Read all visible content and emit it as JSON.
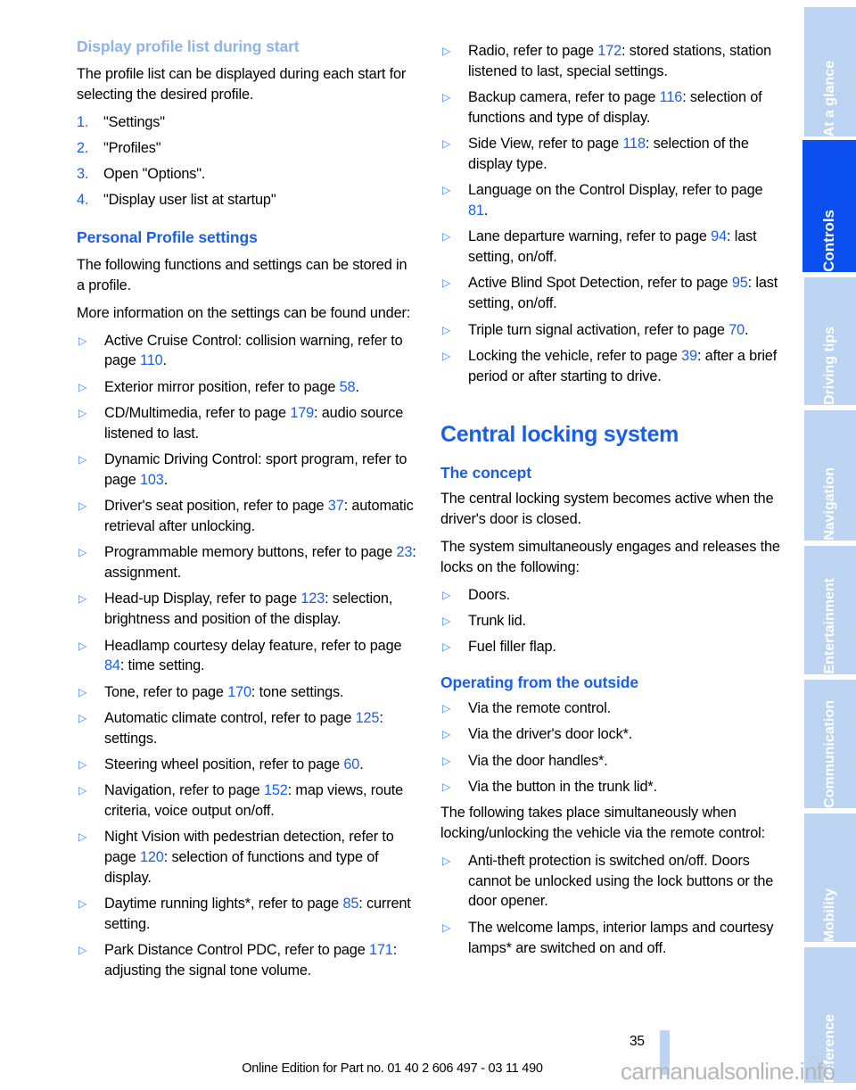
{
  "document": {
    "page_number": "35",
    "footer_note": "Online Edition for Part no. 01 40 2 606 497 - 03 11 490",
    "watermark": "carmanualsonline.info"
  },
  "colors": {
    "heading_blue": "#1a5fe8",
    "heading_light_blue": "#8cb4ec",
    "tab_inactive": "#bcd4f2",
    "tab_active": "#0b4ff0",
    "page_ref": "#1a5fe8"
  },
  "sidebar": {
    "tabs": [
      {
        "label": "At a glance",
        "active": false
      },
      {
        "label": "Controls",
        "active": true
      },
      {
        "label": "Driving tips",
        "active": false
      },
      {
        "label": "Navigation",
        "active": false
      },
      {
        "label": "Entertainment",
        "active": false
      },
      {
        "label": "Communication",
        "active": false
      },
      {
        "label": "Mobility",
        "active": false
      },
      {
        "label": "Reference",
        "active": false
      }
    ]
  },
  "left_column": {
    "heading_continued": "Display profile list during start",
    "intro": "The profile list can be displayed during each start for selecting the desired profile.",
    "steps": [
      {
        "num": "1.",
        "text": "\"Settings\""
      },
      {
        "num": "2.",
        "text": "\"Profiles\""
      },
      {
        "num": "3.",
        "text": "Open \"Options\"."
      },
      {
        "num": "4.",
        "text": "\"Display user list at startup\""
      }
    ],
    "heading_personal": "Personal Profile settings",
    "para1": "The following functions and settings can be stored in a profile.",
    "para2": "More information on the settings can be found under:",
    "bullets": [
      {
        "pre": "Active Cruise Control: collision warning, refer to page ",
        "page": "110",
        "post": "."
      },
      {
        "pre": "Exterior mirror position, refer to page ",
        "page": "58",
        "post": "."
      },
      {
        "pre": "CD/Multimedia, refer to page ",
        "page": "179",
        "post": ": audio source listened to last."
      },
      {
        "pre": "Dynamic Driving Control: sport program, refer to page ",
        "page": "103",
        "post": "."
      },
      {
        "pre": "Driver's seat position, refer to page ",
        "page": "37",
        "post": ": automatic retrieval after unlocking."
      },
      {
        "pre": "Programmable memory buttons, refer to page ",
        "page": "23",
        "post": ": assignment."
      },
      {
        "pre": "Head-up Display, refer to page ",
        "page": "123",
        "post": ": selection, brightness and position of the display."
      },
      {
        "pre": "Headlamp courtesy delay feature, refer to page ",
        "page": "84",
        "post": ": time setting."
      },
      {
        "pre": "Tone, refer to page ",
        "page": "170",
        "post": ": tone settings."
      },
      {
        "pre": "Automatic climate control, refer to page ",
        "page": "125",
        "post": ": settings."
      },
      {
        "pre": "Steering wheel position, refer to page ",
        "page": "60",
        "post": "."
      },
      {
        "pre": "Navigation, refer to page ",
        "page": "152",
        "post": ": map views, route criteria, voice output on/off."
      },
      {
        "pre": "Night Vision with pedestrian detection, refer to page ",
        "page": "120",
        "post": ": selection of functions and type of display."
      },
      {
        "pre": "Daytime running lights*, refer to page ",
        "page": "85",
        "post": ": current setting."
      },
      {
        "pre": "Park Distance Control PDC, refer to page ",
        "page": "171",
        "post": ": adjusting the signal tone volume."
      }
    ]
  },
  "right_column": {
    "bullets_top": [
      {
        "pre": "Radio, refer to page ",
        "page": "172",
        "post": ": stored stations, station listened to last, special settings."
      },
      {
        "pre": "Backup camera, refer to page ",
        "page": "116",
        "post": ": selection of functions and type of display."
      },
      {
        "pre": "Side View, refer to page ",
        "page": "118",
        "post": ": selection of the display type."
      },
      {
        "pre": "Language on the Control Display, refer to page ",
        "page": "81",
        "post": "."
      },
      {
        "pre": "Lane departure warning, refer to page ",
        "page": "94",
        "post": ": last setting, on/off."
      },
      {
        "pre": "Active Blind Spot Detection, refer to page ",
        "page": "95",
        "post": ": last setting, on/off."
      },
      {
        "pre": "Triple turn signal activation, refer to page ",
        "page": "70",
        "post": "."
      },
      {
        "pre": "Locking the vehicle, refer to page ",
        "page": "39",
        "post": ": after a brief period or after starting to drive."
      }
    ],
    "title_central_locking": "Central locking system",
    "heading_concept": "The concept",
    "concept_para1": "The central locking system becomes active when the driver's door is closed.",
    "concept_para2": "The system simultaneously engages and releases the locks on the following:",
    "concept_bullets": [
      {
        "pre": "Doors.",
        "page": "",
        "post": ""
      },
      {
        "pre": "Trunk lid.",
        "page": "",
        "post": ""
      },
      {
        "pre": "Fuel filler flap.",
        "page": "",
        "post": ""
      }
    ],
    "heading_outside": "Operating from the outside",
    "outside_bullets": [
      {
        "pre": "Via the remote control.",
        "page": "",
        "post": ""
      },
      {
        "pre": "Via the driver's door lock*.",
        "page": "",
        "post": ""
      },
      {
        "pre": "Via the door handles*.",
        "page": "",
        "post": ""
      },
      {
        "pre": "Via the button in the trunk lid*.",
        "page": "",
        "post": ""
      }
    ],
    "outside_para": "The following takes place simultaneously when locking/unlocking the vehicle via the remote control:",
    "outside_bullets2": [
      {
        "pre": "Anti-theft protection is switched on/off. Doors cannot be unlocked using the lock buttons or the door opener.",
        "page": "",
        "post": ""
      },
      {
        "pre": "The welcome lamps, interior lamps and courtesy lamps* are switched on and off.",
        "page": "",
        "post": ""
      }
    ]
  }
}
